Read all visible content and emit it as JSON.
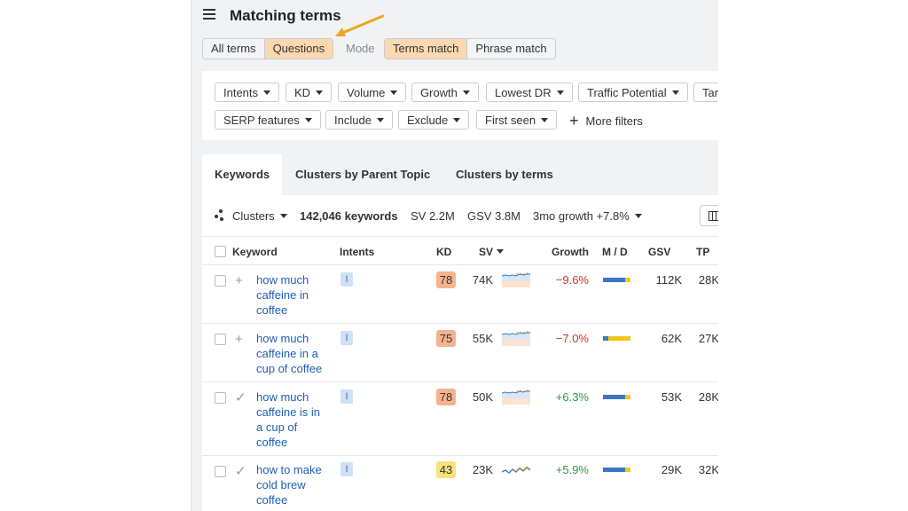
{
  "header": {
    "title": "Matching terms"
  },
  "term_toggle": {
    "all_terms": "All terms",
    "questions": "Questions"
  },
  "mode": {
    "label": "Mode",
    "terms_match": "Terms match",
    "phrase_match": "Phrase match"
  },
  "filters": {
    "row1": [
      "Intents",
      "KD",
      "Volume",
      "Growth",
      "Lowest DR",
      "Traffic Potential",
      "Target"
    ],
    "row2": [
      "SERP features",
      "Include",
      "Exclude",
      "First seen"
    ],
    "more": "More filters"
  },
  "tabs": [
    "Keywords",
    "Clusters by Parent Topic",
    "Clusters by terms"
  ],
  "summary": {
    "clusters": "Clusters",
    "keywords": "142,046 keywords",
    "sv": "SV 2.2M",
    "gsv": "GSV 3.8M",
    "growth": "3mo growth +7.8%"
  },
  "table": {
    "headers": {
      "keyword": "Keyword",
      "intents": "Intents",
      "kd": "KD",
      "sv": "SV",
      "growth": "Growth",
      "md": "M / D",
      "gsv": "GSV",
      "tp": "TP"
    },
    "rows": [
      {
        "mark": "+",
        "keyword": "how much caffeine in coffee",
        "intent": "I",
        "kd": "78",
        "kd_color": "#f7b38e",
        "sv": "74K",
        "spark": "area",
        "growth": "−9.6%",
        "growth_color": "#d0312d",
        "md_fraction": 0.8,
        "gsv": "112K",
        "tp": "28K"
      },
      {
        "mark": "+",
        "keyword": "how much caffeine in a cup of coffee",
        "intent": "I",
        "kd": "75",
        "kd_color": "#f7b38e",
        "sv": "55K",
        "spark": "area",
        "growth": "−7.0%",
        "growth_color": "#d0312d",
        "md_fraction": 0.2,
        "gsv": "62K",
        "tp": "27K"
      },
      {
        "mark": "✓",
        "keyword": "how much caffeine is in a cup of coffee",
        "intent": "I",
        "kd": "78",
        "kd_color": "#f7b38e",
        "sv": "50K",
        "spark": "area",
        "growth": "+6.3%",
        "growth_color": "#2e9b4b",
        "md_fraction": 0.8,
        "gsv": "53K",
        "tp": "28K"
      },
      {
        "mark": "✓",
        "keyword": "how to make cold brew coffee",
        "intent": "I",
        "kd": "43",
        "kd_color": "#fbe27a",
        "sv": "23K",
        "spark": "line",
        "growth": "+5.9%",
        "growth_color": "#2e9b4b",
        "md_fraction": 0.8,
        "gsv": "29K",
        "tp": "32K"
      }
    ]
  },
  "colors": {
    "accent_orange": "#fbd8b0",
    "link_blue": "#1f5fb4",
    "mobile_blue": "#3a78c4",
    "desktop_yellow": "#f2c615",
    "arrow": "#f0a520"
  }
}
